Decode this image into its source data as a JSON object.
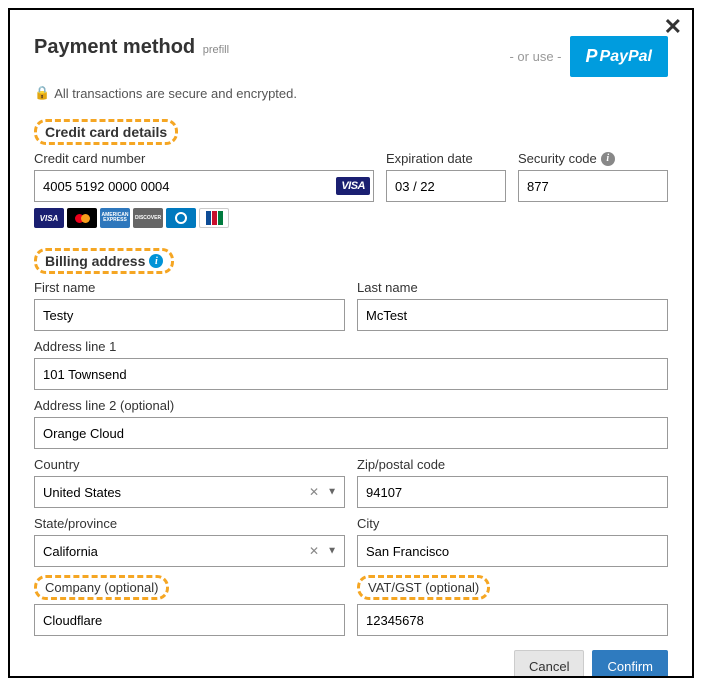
{
  "header": {
    "title": "Payment method",
    "prefill": "prefill",
    "or_use": "- or use -",
    "paypal_label": "PayPal"
  },
  "secure_text": "All transactions are secure and encrypted.",
  "sections": {
    "cc_title": "Credit card details",
    "billing_title": "Billing address"
  },
  "cc": {
    "number_label": "Credit card number",
    "number_value": "4005 5192 0000 0004",
    "card_type": "VISA",
    "exp_label": "Expiration date",
    "exp_value": "03 / 22",
    "cvv_label": "Security code",
    "cvv_value": "877"
  },
  "billing": {
    "first_name_label": "First name",
    "first_name_value": "Testy",
    "last_name_label": "Last name",
    "last_name_value": "McTest",
    "addr1_label": "Address line 1",
    "addr1_value": "101 Townsend",
    "addr2_label": "Address line 2 (optional)",
    "addr2_value": "Orange Cloud",
    "country_label": "Country",
    "country_value": "United States",
    "zip_label": "Zip/postal code",
    "zip_value": "94107",
    "state_label": "State/province",
    "state_value": "California",
    "city_label": "City",
    "city_value": "San Francisco",
    "company_label": "Company (optional)",
    "company_value": "Cloudflare",
    "vat_label": "VAT/GST (optional)",
    "vat_value": "12345678"
  },
  "footer": {
    "cancel": "Cancel",
    "confirm": "Confirm"
  }
}
